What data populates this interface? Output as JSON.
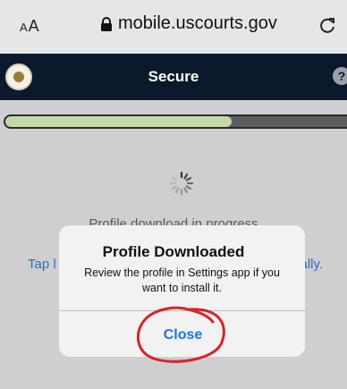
{
  "browser": {
    "text_size_control": [
      "A",
      "A"
    ],
    "url": "mobile.uscourts.gov",
    "reload_icon": "reload-icon"
  },
  "header": {
    "title": "Secure",
    "help_label": "?",
    "logo_icon": "seal-icon"
  },
  "progress": {
    "fraction": 0.64
  },
  "page": {
    "status_text": "Profile download in progress",
    "instruction_left": "Tap l",
    "instruction_right": "cally."
  },
  "dialog": {
    "title": "Profile Downloaded",
    "message": "Review the profile in Settings app if you want to install it.",
    "close_label": "Close"
  },
  "colors": {
    "header_bg": "#0a1a2c",
    "progress_fill": "#c5d9a8",
    "link_blue": "#1c74e6",
    "annotation_red": "#d8232a"
  }
}
